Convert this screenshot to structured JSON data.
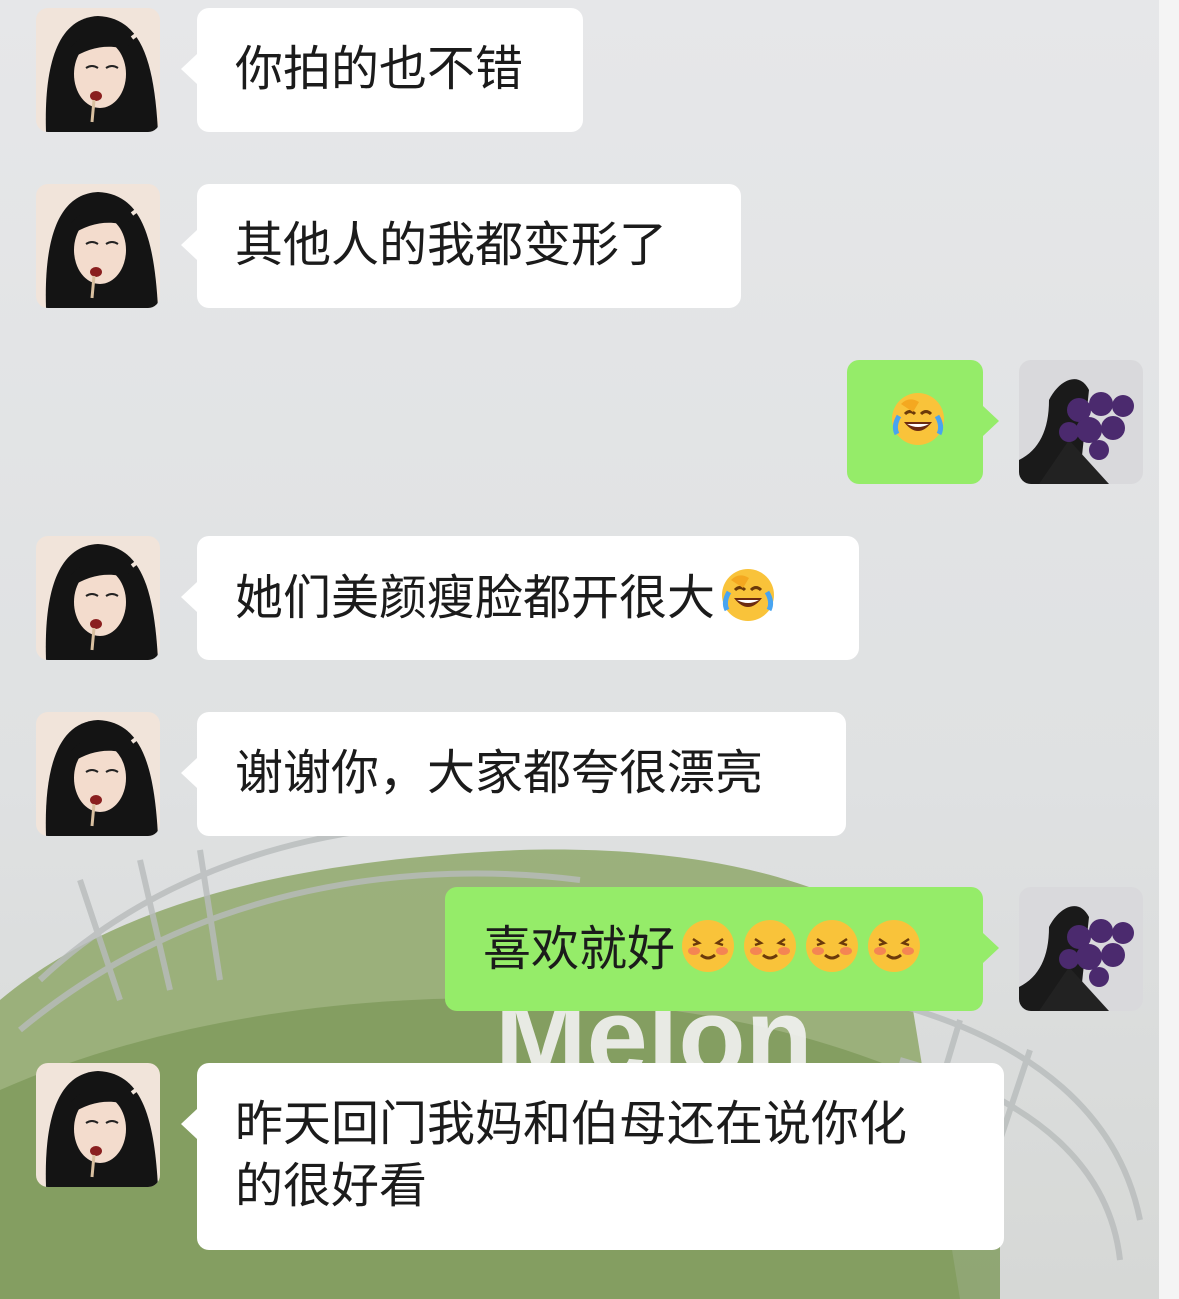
{
  "background_text": "Melon",
  "messages": [
    {
      "side": "in",
      "sender": "contact",
      "text": "你拍的也不错"
    },
    {
      "side": "in",
      "sender": "contact",
      "text": "其他人的我都变形了"
    },
    {
      "side": "out",
      "sender": "me",
      "text": "",
      "emojis": [
        "laughing-crying-emoji"
      ]
    },
    {
      "side": "in",
      "sender": "contact",
      "text": "她们美颜瘦脸都开很大",
      "emojis": [
        "laughing-crying-emoji"
      ]
    },
    {
      "side": "in",
      "sender": "contact",
      "text": "谢谢你，大家都夸很漂亮"
    },
    {
      "side": "out",
      "sender": "me",
      "text": "喜欢就好",
      "emojis": [
        "blushing-smile-emoji",
        "blushing-smile-emoji",
        "blushing-smile-emoji",
        "blushing-smile-emoji"
      ]
    },
    {
      "side": "in",
      "sender": "contact",
      "text": "昨天回门我妈和伯母还在说你化\n的很好看"
    }
  ],
  "colors": {
    "incoming_bubble": "#ffffff",
    "outgoing_bubble": "#95ec69",
    "chat_background": "#e7e7e9"
  }
}
